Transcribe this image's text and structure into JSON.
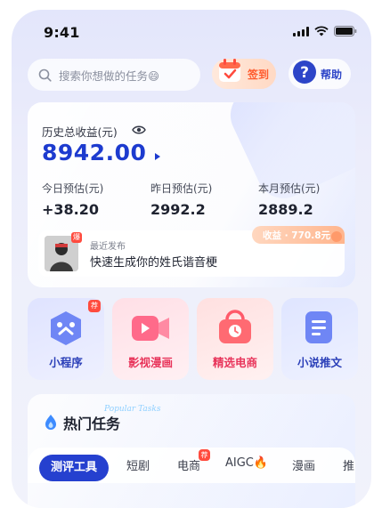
{
  "status_bar": {
    "time": "9:41"
  },
  "header": {
    "search_placeholder": "搜索你想做的任务😄",
    "signin_label": "签到",
    "help_label": "帮助"
  },
  "earnings": {
    "total_label": "历史总收益(元)",
    "total_value": "8942.00",
    "stats": [
      {
        "label": "今日预估(元)",
        "value": "+38.20"
      },
      {
        "label": "昨日预估(元)",
        "value": "2992.2"
      },
      {
        "label": "本月预估(元)",
        "value": "2889.2"
      }
    ],
    "recent": {
      "badge": "爆",
      "label": "最近发布",
      "title": "快速生成你的姓氏谐音梗",
      "income": "收益 · 770.8元"
    }
  },
  "features": [
    {
      "label": "小程序",
      "badge": "荐",
      "color": "#2b3fb8"
    },
    {
      "label": "影视漫画",
      "color": "#e8345a"
    },
    {
      "label": "精选电商",
      "color": "#e8345a"
    },
    {
      "label": "小说推文",
      "color": "#2b3fb8"
    }
  ],
  "hot_tasks": {
    "title": "热门任务",
    "deco_text": "Popular Tasks",
    "tabs": [
      {
        "label": "测评工具",
        "active": true
      },
      {
        "label": "短剧"
      },
      {
        "label": "电商",
        "badge": "荐"
      },
      {
        "label": "AIGC🔥"
      },
      {
        "label": "漫画"
      },
      {
        "label": "推"
      }
    ]
  },
  "colors": {
    "accent": "#2540cf",
    "brand_red": "#ff4b3e",
    "orange": "#ff5a2c"
  }
}
